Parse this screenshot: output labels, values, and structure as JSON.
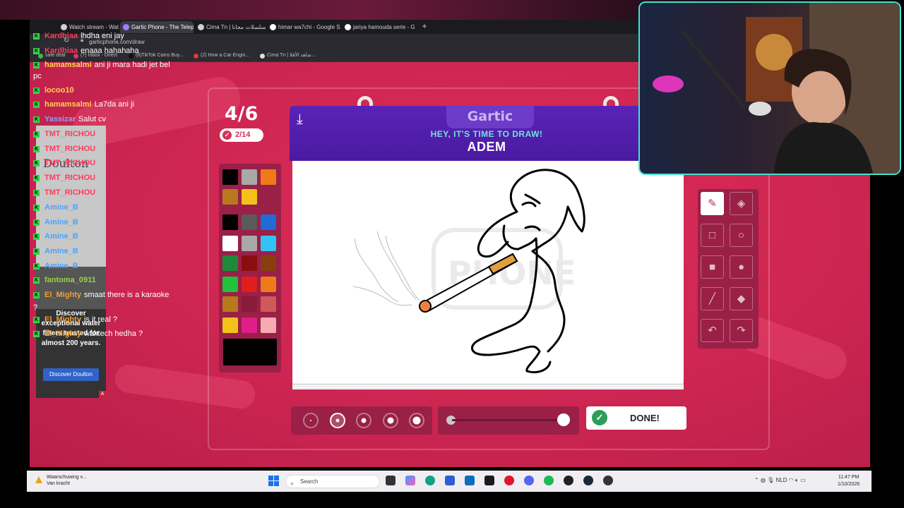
{
  "overlay": {
    "stream_id": "c=0111542bdc"
  },
  "browser": {
    "tabs": [
      {
        "label": "Watch stream - Watch Liv",
        "active": false
      },
      {
        "label": "Gartic Phone - The Teleph",
        "active": true
      },
      {
        "label": "Cima Tn | المسلسلات مجانا",
        "active": false
      },
      {
        "label": "himar wa7chi - Google Se",
        "active": false
      },
      {
        "label": "jariya hamouda serie - Go",
        "active": false
      }
    ],
    "new_tab": "+",
    "url": "garticphone.com/draw",
    "bookmarks": [
      "safe deal",
      "(7) Inbox - Direct",
      "(6)TikTok Coins Buy...",
      "(2) How a Car Engin...",
      "Cima Tn | شاهد الأفلا..."
    ]
  },
  "chat": {
    "messages": [
      {
        "user": "Kardhiaa",
        "text": "lhdha eni jay",
        "color": "#ff3b5c"
      },
      {
        "user": "Kardhiaa",
        "text": "enaaa hahahaha",
        "color": "#ff3b5c"
      },
      {
        "user": "hamamsalmi",
        "text": "ani ji mara hadi jet bel",
        "color": "#ffd54f"
      },
      {
        "user": "",
        "text": "pc",
        "color": "#ffffff"
      },
      {
        "user": "locoo10",
        "text": "",
        "color": "#ffd54f"
      },
      {
        "user": "hamamsalmi",
        "text": "La7da ani ji",
        "color": "#ffd54f"
      },
      {
        "user": "Yassizar",
        "text": "Salut cv",
        "color": "#7fa7ff"
      },
      {
        "user": "TMT_RICHOU",
        "text": "",
        "color": "#ff3b5c"
      },
      {
        "user": "TMT_RICHOU",
        "text": "",
        "color": "#ff3b5c"
      },
      {
        "user": "TMT_RICHOU",
        "text": "",
        "color": "#ff3b5c"
      },
      {
        "user": "TMT_RICHOU",
        "text": "",
        "color": "#ff3b5c"
      },
      {
        "user": "TMT_RICHOU",
        "text": "",
        "color": "#ff3b5c"
      },
      {
        "user": "Amine_B",
        "text": "",
        "color": "#4aa3ff"
      },
      {
        "user": "Amine_B",
        "text": "",
        "color": "#4aa3ff"
      },
      {
        "user": "Amine_B",
        "text": "",
        "color": "#4aa3ff"
      },
      {
        "user": "Amine_B",
        "text": "",
        "color": "#4aa3ff"
      },
      {
        "user": "Amine_B",
        "text": "",
        "color": "#4aa3ff"
      },
      {
        "user": "fantoma_0911",
        "text": "",
        "color": "#9ad14a"
      },
      {
        "user": "El_Mighty",
        "text": "smaat there is a karaoke",
        "color": "#f0a030"
      },
      {
        "user": "",
        "text": "?",
        "color": "#ffffff"
      },
      {
        "user": "El_Mighty",
        "text": "is it real ?",
        "color": "#f0a030"
      },
      {
        "user": "El_Mighty",
        "text": "waktech hedha ?",
        "color": "#f0a030"
      }
    ]
  },
  "ad": {
    "brand": "Doulton",
    "headline": "Discover exceptional water filters trusted for almost 200 years.",
    "cta": "Discover Doulton",
    "marker": "A"
  },
  "game": {
    "round": "4/6",
    "players_done": "2/14",
    "logo": "Gartic",
    "prompt_label": "HEY, IT'S TIME TO DRAW!",
    "word": "ADEM",
    "done_label": "DONE!",
    "palette": [
      "#000000",
      "#a8a8a8",
      "#f07a1a",
      "#b8781e",
      "#f3c21a",
      "#000000",
      "#5a5a5a",
      "#1f6bd8",
      "#ffffff",
      "#a8a8a8",
      "#33c2f2",
      "#1e8a38",
      "#8a0e0e",
      "#8a3e10",
      "#22c23a",
      "#e01e1e",
      "#f07a1a",
      "#b8781e",
      "#8a1a3a",
      "#cf5a5a",
      "#f3c21a",
      "#e01e8a",
      "#f7aab0"
    ],
    "current_color": "#000000",
    "tools": [
      {
        "name": "pencil",
        "glyph": "✎",
        "selected": true
      },
      {
        "name": "eraser",
        "glyph": "◈",
        "selected": false
      },
      {
        "name": "rect-outline",
        "glyph": "□",
        "selected": false
      },
      {
        "name": "circle-outline",
        "glyph": "○",
        "selected": false
      },
      {
        "name": "rect-fill",
        "glyph": "■",
        "selected": false
      },
      {
        "name": "circle-fill",
        "glyph": "●",
        "selected": false
      },
      {
        "name": "line",
        "glyph": "╱",
        "selected": false
      },
      {
        "name": "fill-bucket",
        "glyph": "◆",
        "selected": false
      },
      {
        "name": "undo",
        "glyph": "↶",
        "selected": false
      },
      {
        "name": "redo",
        "glyph": "↷",
        "selected": false
      }
    ],
    "brush_sizes": 5,
    "selected_brush": 2,
    "opacity": 1.0
  },
  "taskbar": {
    "warning_title": "Waarschuwing v...",
    "warning_sub": "Van kracht",
    "search_placeholder": "Search",
    "tray_lang": "NLD",
    "time": "11:47 PM",
    "date": "1/10/2026"
  },
  "colors": {
    "accent": "#d4305a",
    "header": "#5a23b8",
    "cam_border": "#3fe3d0"
  }
}
